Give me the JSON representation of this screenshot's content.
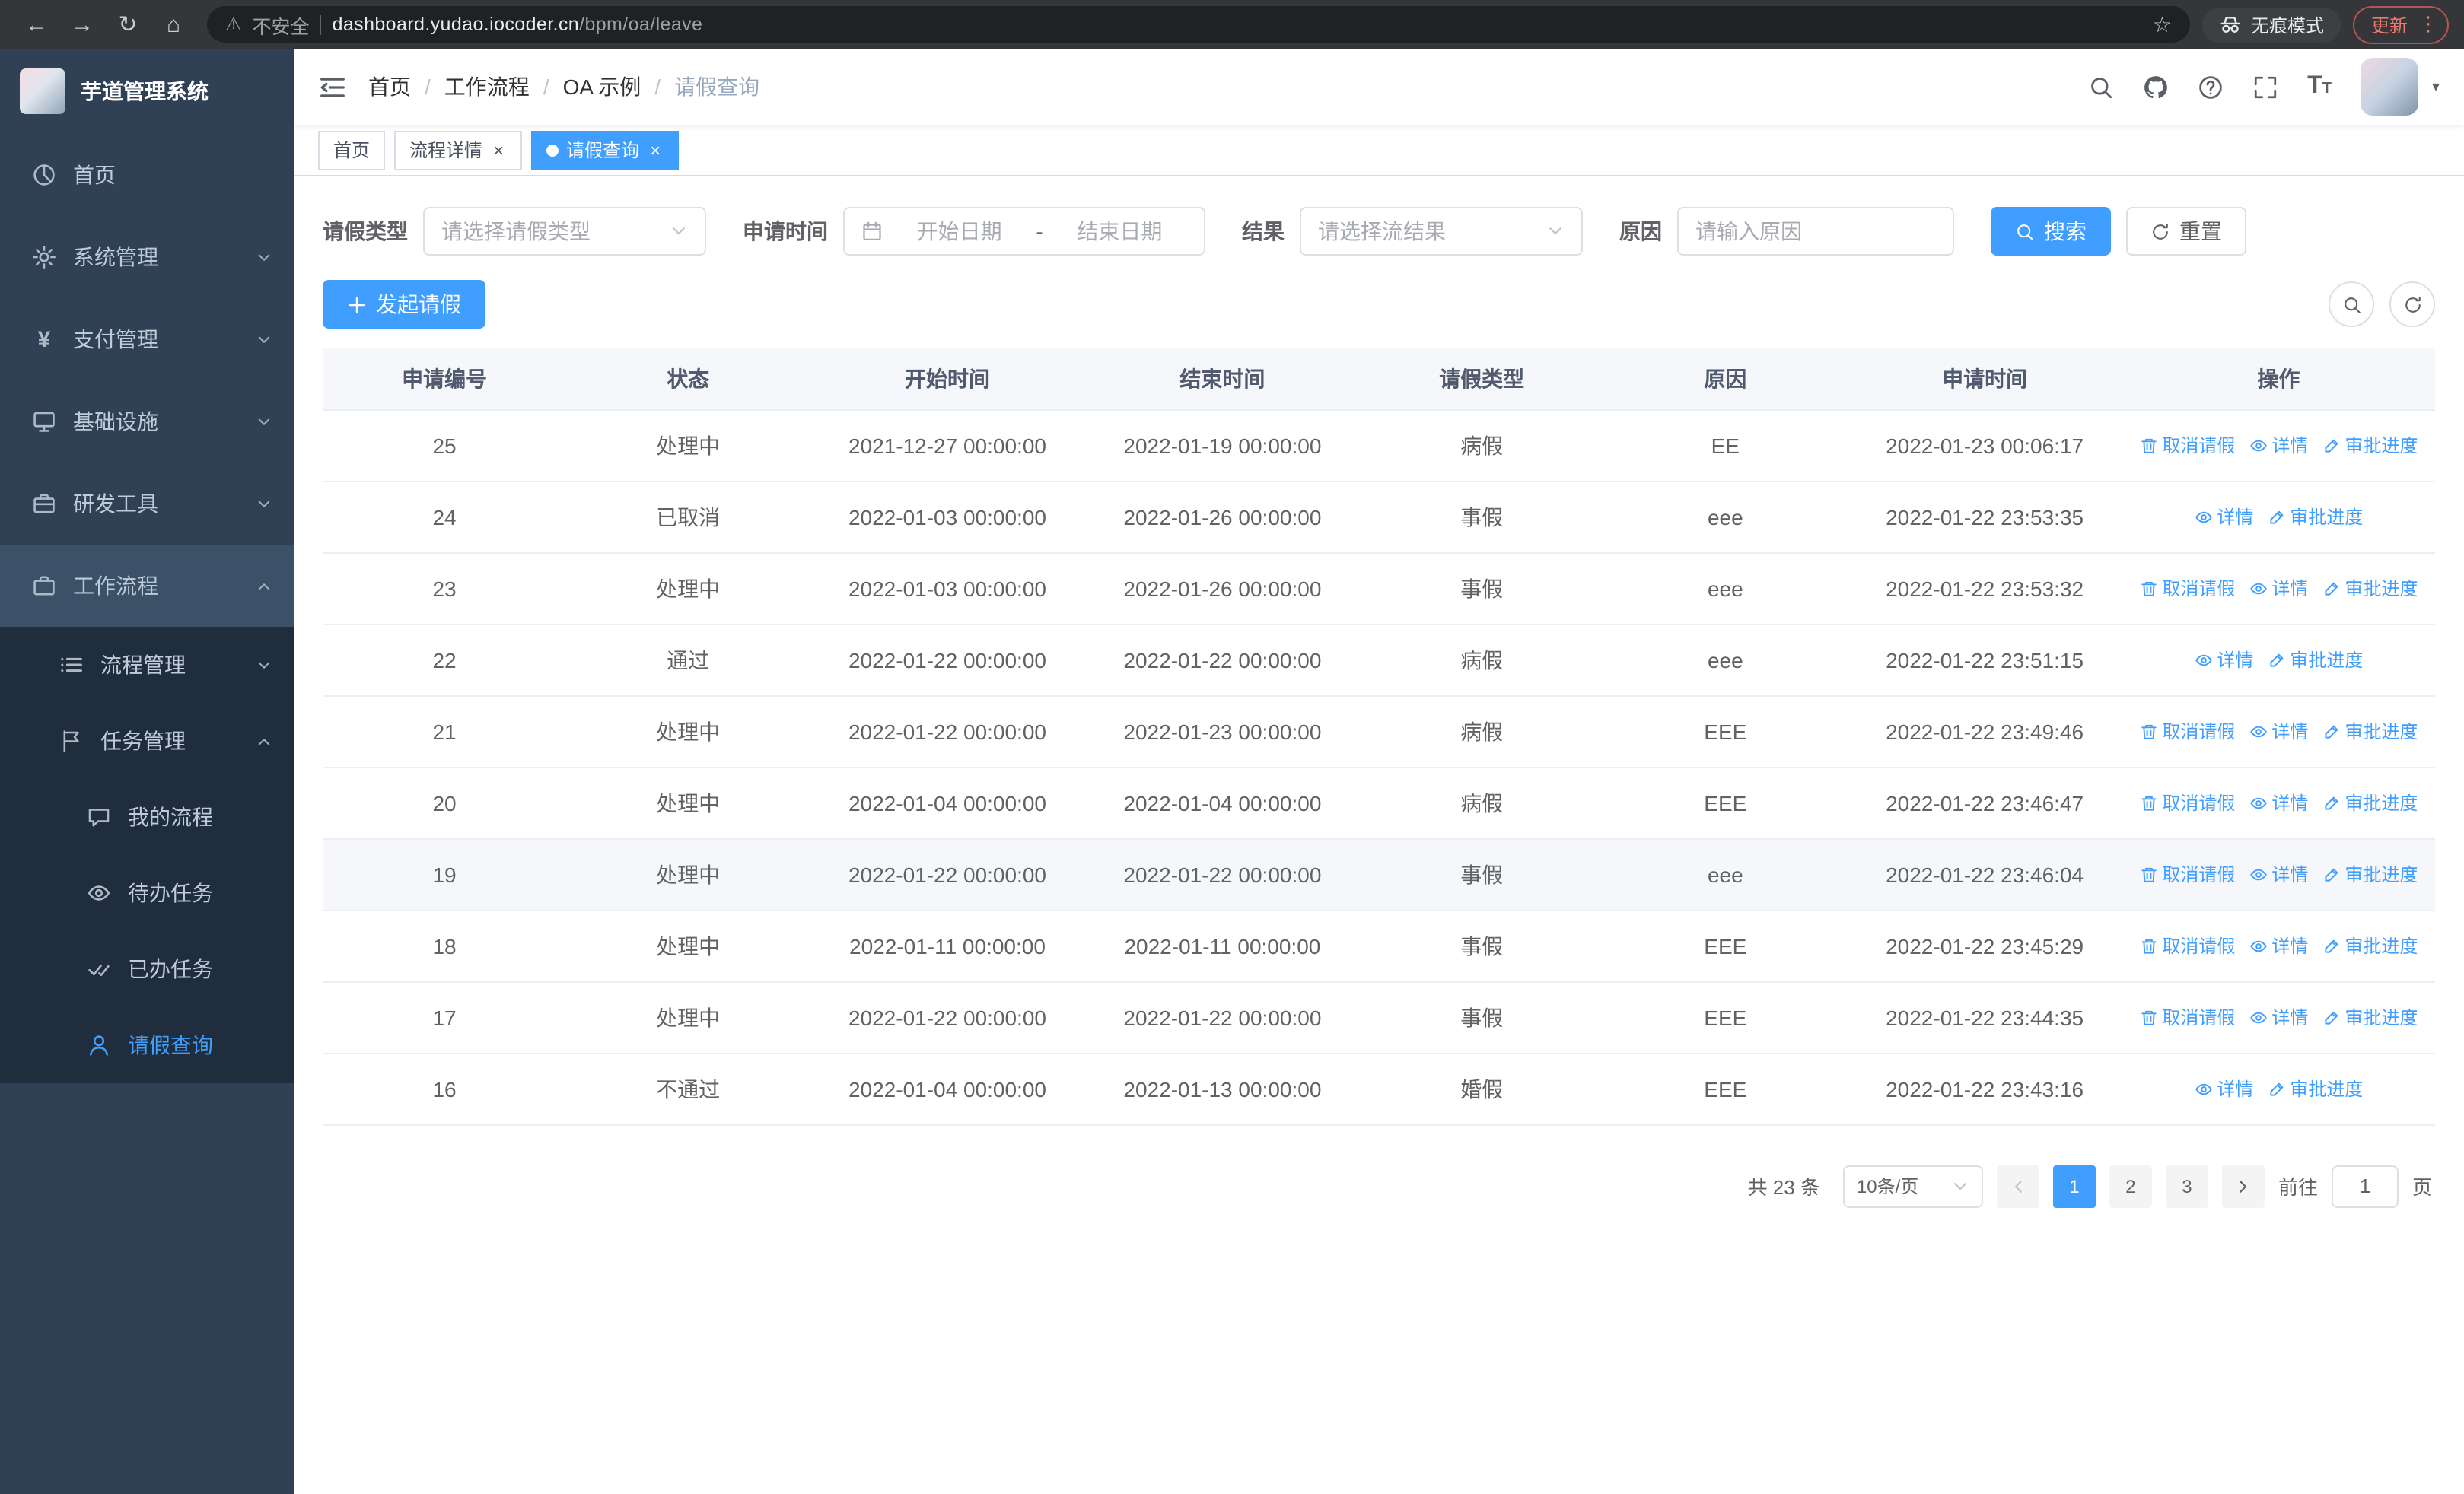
{
  "theme": {
    "primary": "#409eff",
    "sidebar_bg": "#304156",
    "submenu_bg": "#1f2d3d"
  },
  "icons": {
    "back": "←",
    "forward": "→",
    "reload": "↻",
    "home": "⌂",
    "warning": "⚠",
    "star": "☆",
    "dots": "⋮",
    "caret": "▾",
    "close": "×"
  },
  "browser": {
    "security_label": "不安全",
    "url_host": "dashboard.yudao.iocoder.cn",
    "url_path": "/bpm/oa/leave",
    "incognito_label": "无痕模式",
    "update_label": "更新"
  },
  "sidebar": {
    "logo_title": "芋道管理系统",
    "items": [
      {
        "label": "首页",
        "icon": "dashboard-icon",
        "level": 1
      },
      {
        "label": "系统管理",
        "icon": "gear-icon",
        "level": 1,
        "chevron": "down"
      },
      {
        "label": "支付管理",
        "icon": "yen-icon",
        "level": 1,
        "chevron": "down"
      },
      {
        "label": "基础设施",
        "icon": "monitor-icon",
        "level": 1,
        "chevron": "down"
      },
      {
        "label": "研发工具",
        "icon": "toolbox-icon",
        "level": 1,
        "chevron": "down"
      },
      {
        "label": "工作流程",
        "icon": "briefcase-icon",
        "level": 1,
        "chevron": "up",
        "highlight": true
      },
      {
        "label": "流程管理",
        "icon": "list-icon",
        "level": 2,
        "chevron": "down"
      },
      {
        "label": "任务管理",
        "icon": "flag-icon",
        "level": 2,
        "chevron": "up"
      },
      {
        "label": "我的流程",
        "icon": "chat-icon",
        "level": 3
      },
      {
        "label": "待办任务",
        "icon": "eye-icon",
        "level": 3
      },
      {
        "label": "已办任务",
        "icon": "done-icon",
        "level": 3
      },
      {
        "label": "请假查询",
        "icon": "user-icon",
        "level": 3,
        "active": true
      }
    ]
  },
  "header": {
    "breadcrumb": [
      "首页",
      "工作流程",
      "OA 示例",
      "请假查询"
    ]
  },
  "tabs": [
    {
      "label": "首页",
      "closable": false,
      "active": false
    },
    {
      "label": "流程详情",
      "closable": true,
      "active": false
    },
    {
      "label": "请假查询",
      "closable": true,
      "active": true
    }
  ],
  "filters": {
    "leave_type_label": "请假类型",
    "leave_type_placeholder": "请选择请假类型",
    "apply_time_label": "申请时间",
    "start_date_placeholder": "开始日期",
    "range_separator": "-",
    "end_date_placeholder": "结束日期",
    "result_label": "结果",
    "result_placeholder": "请选择流结果",
    "reason_label": "原因",
    "reason_placeholder": "请输入原因",
    "search_label": "搜索",
    "reset_label": "重置"
  },
  "toolbar": {
    "create_label": "发起请假"
  },
  "table": {
    "columns": [
      "申请编号",
      "状态",
      "开始时间",
      "结束时间",
      "请假类型",
      "原因",
      "申请时间",
      "操作"
    ],
    "action_labels": {
      "cancel": "取消请假",
      "detail": "详情",
      "progress": "审批进度"
    },
    "rows": [
      {
        "id": "25",
        "status": "处理中",
        "start": "2021-12-27 00:00:00",
        "end": "2022-01-19 00:00:00",
        "type": "病假",
        "reason": "EE",
        "applied": "2022-01-23 00:06:17",
        "actions": [
          "cancel",
          "detail",
          "progress"
        ]
      },
      {
        "id": "24",
        "status": "已取消",
        "start": "2022-01-03 00:00:00",
        "end": "2022-01-26 00:00:00",
        "type": "事假",
        "reason": "eee",
        "applied": "2022-01-22 23:53:35",
        "actions": [
          "detail",
          "progress"
        ]
      },
      {
        "id": "23",
        "status": "处理中",
        "start": "2022-01-03 00:00:00",
        "end": "2022-01-26 00:00:00",
        "type": "事假",
        "reason": "eee",
        "applied": "2022-01-22 23:53:32",
        "actions": [
          "cancel",
          "detail",
          "progress"
        ]
      },
      {
        "id": "22",
        "status": "通过",
        "start": "2022-01-22 00:00:00",
        "end": "2022-01-22 00:00:00",
        "type": "病假",
        "reason": "eee",
        "applied": "2022-01-22 23:51:15",
        "actions": [
          "detail",
          "progress"
        ]
      },
      {
        "id": "21",
        "status": "处理中",
        "start": "2022-01-22 00:00:00",
        "end": "2022-01-23 00:00:00",
        "type": "病假",
        "reason": "EEE",
        "applied": "2022-01-22 23:49:46",
        "actions": [
          "cancel",
          "detail",
          "progress"
        ]
      },
      {
        "id": "20",
        "status": "处理中",
        "start": "2022-01-04 00:00:00",
        "end": "2022-01-04 00:00:00",
        "type": "病假",
        "reason": "EEE",
        "applied": "2022-01-22 23:46:47",
        "actions": [
          "cancel",
          "detail",
          "progress"
        ]
      },
      {
        "id": "19",
        "status": "处理中",
        "start": "2022-01-22 00:00:00",
        "end": "2022-01-22 00:00:00",
        "type": "事假",
        "reason": "eee",
        "applied": "2022-01-22 23:46:04",
        "actions": [
          "cancel",
          "detail",
          "progress"
        ],
        "highlighted": true
      },
      {
        "id": "18",
        "status": "处理中",
        "start": "2022-01-11 00:00:00",
        "end": "2022-01-11 00:00:00",
        "type": "事假",
        "reason": "EEE",
        "applied": "2022-01-22 23:45:29",
        "actions": [
          "cancel",
          "detail",
          "progress"
        ]
      },
      {
        "id": "17",
        "status": "处理中",
        "start": "2022-01-22 00:00:00",
        "end": "2022-01-22 00:00:00",
        "type": "事假",
        "reason": "EEE",
        "applied": "2022-01-22 23:44:35",
        "actions": [
          "cancel",
          "detail",
          "progress"
        ]
      },
      {
        "id": "16",
        "status": "不通过",
        "start": "2022-01-04 00:00:00",
        "end": "2022-01-13 00:00:00",
        "type": "婚假",
        "reason": "EEE",
        "applied": "2022-01-22 23:43:16",
        "actions": [
          "detail",
          "progress"
        ]
      }
    ]
  },
  "pagination": {
    "total_label": "共 23 条",
    "page_size": "10条/页",
    "pages": [
      "1",
      "2",
      "3"
    ],
    "active_page": "1",
    "goto_label": "前往",
    "goto_value": "1",
    "page_unit": "页"
  }
}
